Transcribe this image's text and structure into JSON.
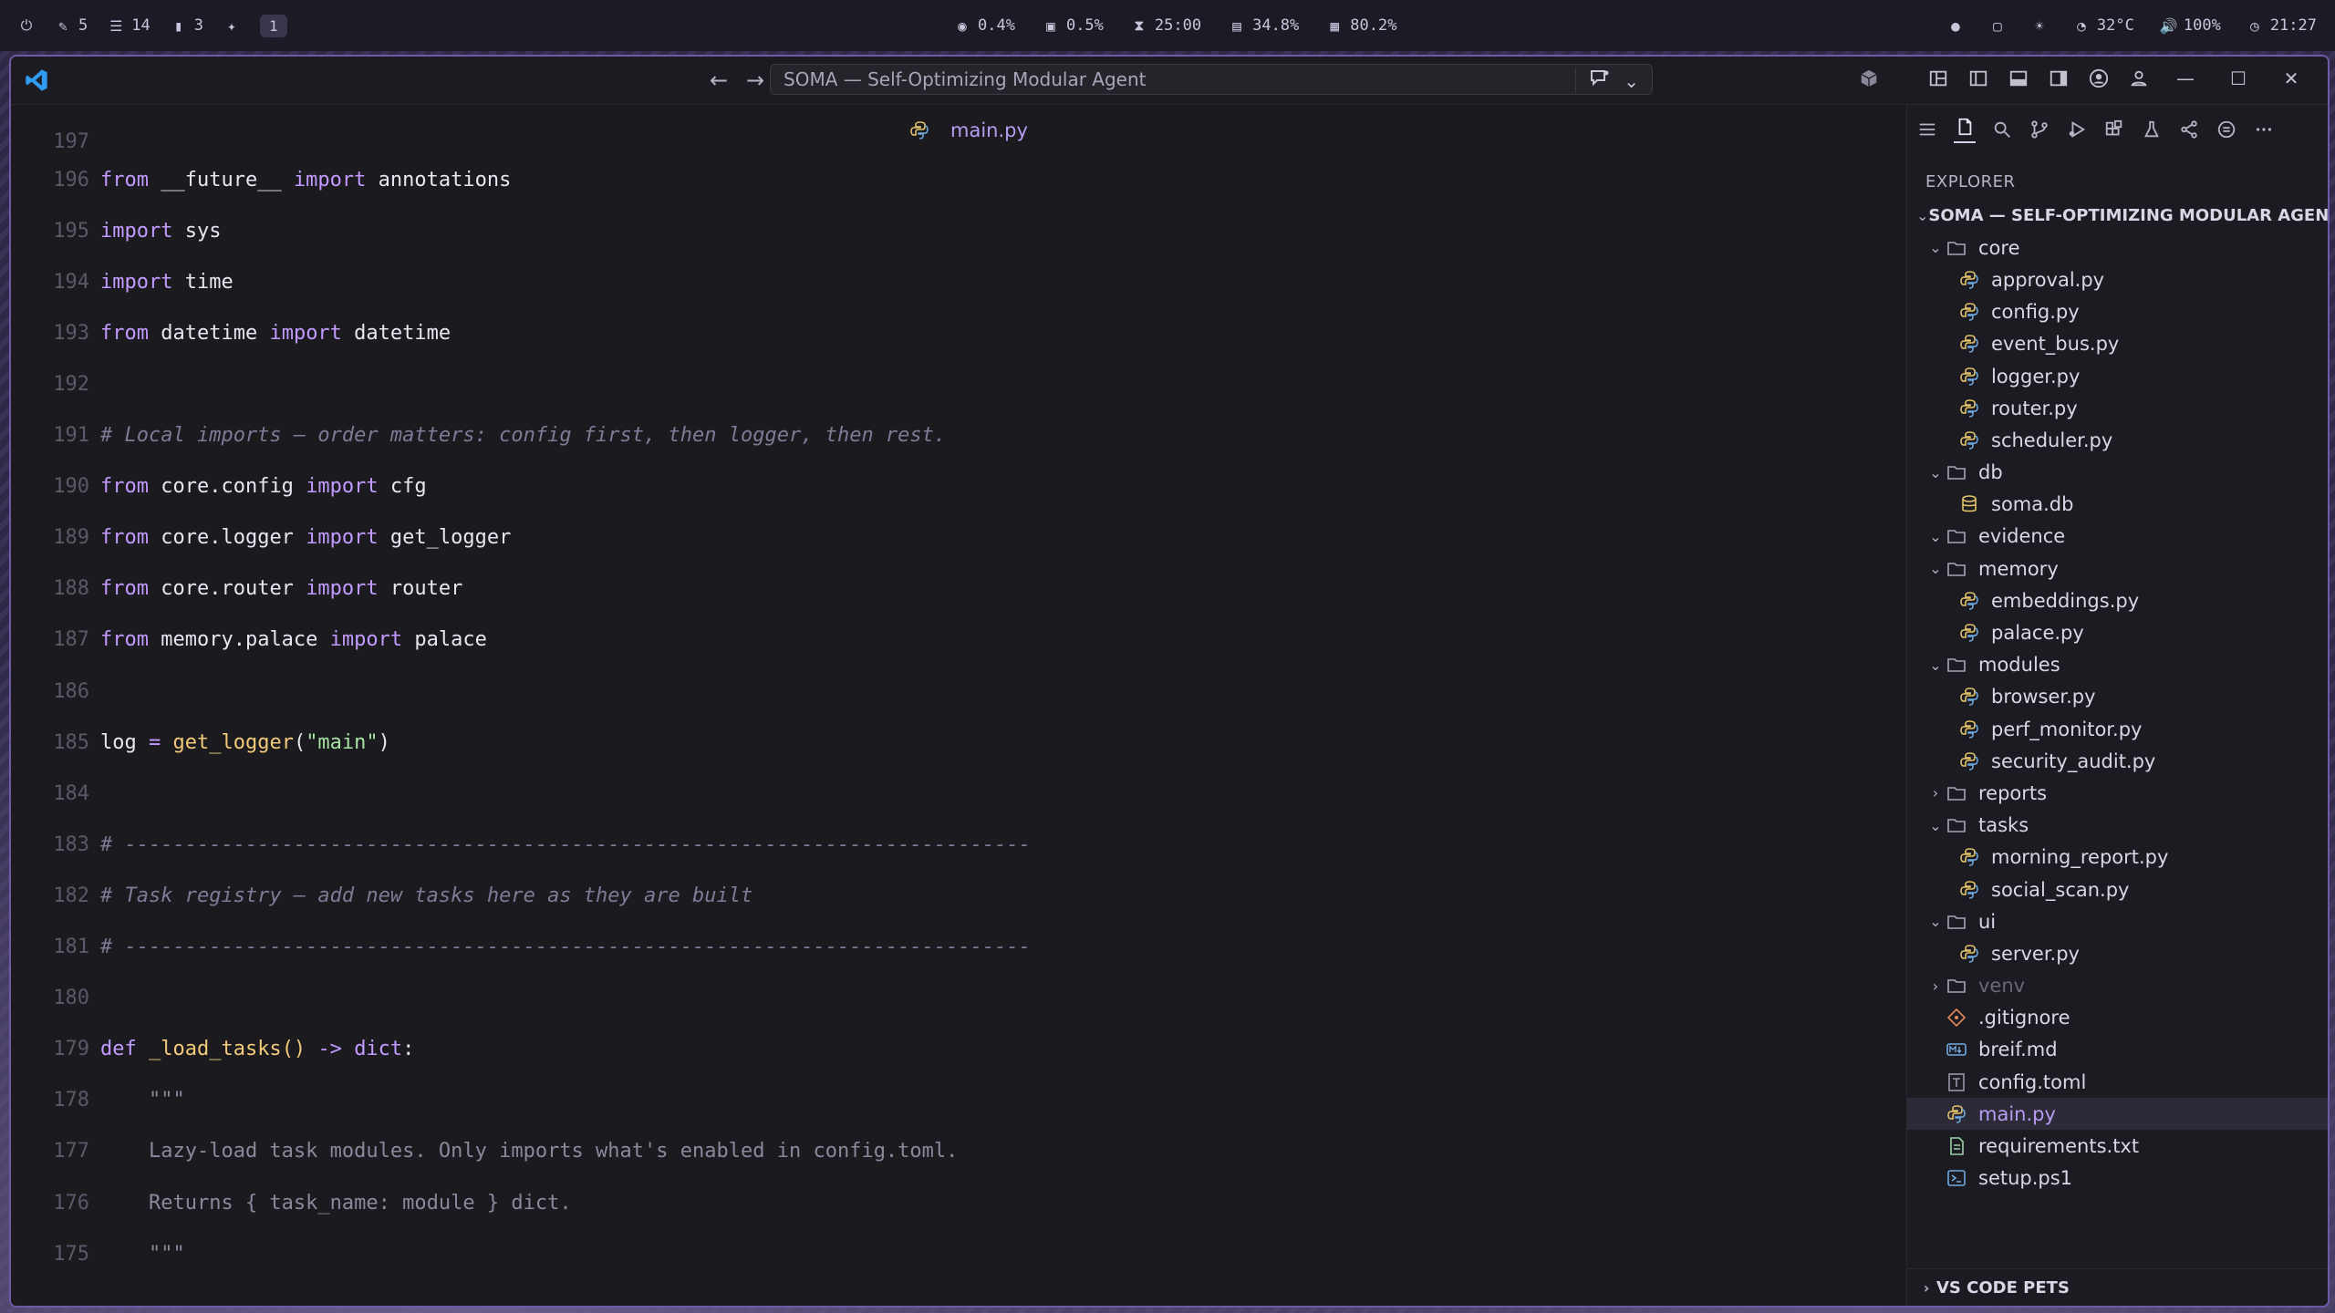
{
  "sysbar": {
    "left": [
      {
        "icon": "power-icon",
        "text": ""
      },
      {
        "icon": "edit-icon",
        "text": "5"
      },
      {
        "icon": "checklist-icon",
        "text": "14"
      },
      {
        "icon": "trash-icon",
        "text": "3"
      },
      {
        "icon": "sparkle-icon",
        "text": ""
      }
    ],
    "workspace": "1",
    "center": [
      {
        "icon": "cpu-icon",
        "text": "0.4%"
      },
      {
        "icon": "gpu-icon",
        "text": "0.5%"
      },
      {
        "icon": "hourglass-icon",
        "text": "25:00"
      },
      {
        "icon": "memory-icon",
        "text": "34.8%"
      },
      {
        "icon": "disk-icon",
        "text": "80.2%"
      }
    ],
    "right": [
      {
        "icon": "circle-icon",
        "text": ""
      },
      {
        "icon": "screenshot-icon",
        "text": ""
      },
      {
        "icon": "brightness-icon",
        "text": ""
      },
      {
        "icon": "temperature-icon",
        "text": "32°C"
      },
      {
        "icon": "volume-icon",
        "text": "100%"
      },
      {
        "icon": "clock-icon",
        "text": "21:27"
      }
    ]
  },
  "titlebar": {
    "command_center": "SOMA — Self-Optimizing Modular Agent"
  },
  "editor": {
    "tab_title": "main.py",
    "top_partial_line_number": "197",
    "lines": [
      {
        "n": "196",
        "tokens": [
          [
            "kw",
            "from "
          ],
          [
            "id",
            "__future__ "
          ],
          [
            "kw",
            "import "
          ],
          [
            "id",
            "annotations"
          ]
        ]
      },
      {
        "n": "195",
        "tokens": [
          [
            "kw",
            "import "
          ],
          [
            "id",
            "sys"
          ]
        ]
      },
      {
        "n": "194",
        "tokens": [
          [
            "kw",
            "import "
          ],
          [
            "id",
            "time"
          ]
        ]
      },
      {
        "n": "193",
        "tokens": [
          [
            "kw",
            "from "
          ],
          [
            "id",
            "datetime "
          ],
          [
            "kw",
            "import "
          ],
          [
            "id",
            "datetime"
          ]
        ]
      },
      {
        "n": "192",
        "tokens": []
      },
      {
        "n": "191",
        "tokens": [
          [
            "cm",
            "# Local imports — order matters: config first, then logger, then rest."
          ]
        ]
      },
      {
        "n": "190",
        "tokens": [
          [
            "kw",
            "from "
          ],
          [
            "id",
            "core.config "
          ],
          [
            "kw",
            "import "
          ],
          [
            "id",
            "cfg"
          ]
        ]
      },
      {
        "n": "189",
        "tokens": [
          [
            "kw",
            "from "
          ],
          [
            "id",
            "core.logger "
          ],
          [
            "kw",
            "import "
          ],
          [
            "id",
            "get_logger"
          ]
        ]
      },
      {
        "n": "188",
        "tokens": [
          [
            "kw",
            "from "
          ],
          [
            "id",
            "core.router "
          ],
          [
            "kw",
            "import "
          ],
          [
            "id",
            "router"
          ]
        ]
      },
      {
        "n": "187",
        "tokens": [
          [
            "kw",
            "from "
          ],
          [
            "id",
            "memory.palace "
          ],
          [
            "kw",
            "import "
          ],
          [
            "id",
            "palace"
          ]
        ]
      },
      {
        "n": "186",
        "tokens": []
      },
      {
        "n": "185",
        "tokens": [
          [
            "id",
            "log "
          ],
          [
            "op",
            "= "
          ],
          [
            "fn",
            "get_logger"
          ],
          [
            "id",
            "("
          ],
          [
            "str",
            "\"main\""
          ],
          [
            "id",
            ")"
          ]
        ]
      },
      {
        "n": "184",
        "tokens": []
      },
      {
        "n": "183",
        "tokens": [
          [
            "cm",
            "# ---------------------------------------------------------------------------"
          ]
        ]
      },
      {
        "n": "182",
        "tokens": [
          [
            "cm",
            "# Task registry — add new tasks here as they are built"
          ]
        ]
      },
      {
        "n": "181",
        "tokens": [
          [
            "cm",
            "# ---------------------------------------------------------------------------"
          ]
        ]
      },
      {
        "n": "180",
        "tokens": []
      },
      {
        "n": "179",
        "tokens": [
          [
            "kw",
            "def "
          ],
          [
            "fn",
            "_load_tasks"
          ],
          [
            "fn",
            "() "
          ],
          [
            "op",
            "-> "
          ],
          [
            "kw",
            "dict"
          ],
          [
            "id",
            ":"
          ]
        ]
      },
      {
        "n": "178",
        "tokens": [
          [
            "doc",
            "    \"\"\""
          ]
        ]
      },
      {
        "n": "177",
        "tokens": [
          [
            "doc",
            "    Lazy-load task modules. Only imports what's enabled in config.toml."
          ]
        ]
      },
      {
        "n": "176",
        "tokens": [
          [
            "doc",
            "    Returns { task_name: module } dict."
          ]
        ]
      },
      {
        "n": "175",
        "tokens": [
          [
            "doc",
            "    \"\"\""
          ]
        ]
      }
    ]
  },
  "sidebar": {
    "explorer_label": "EXPLORER",
    "root": "SOMA — SELF-OPTIMIZING MODULAR AGENT",
    "items": [
      {
        "label": "core",
        "kind": "folder",
        "open": true,
        "depth": 1
      },
      {
        "label": "approval.py",
        "kind": "py",
        "depth": 2
      },
      {
        "label": "config.py",
        "kind": "py",
        "depth": 2
      },
      {
        "label": "event_bus.py",
        "kind": "py",
        "depth": 2
      },
      {
        "label": "logger.py",
        "kind": "py",
        "depth": 2
      },
      {
        "label": "router.py",
        "kind": "py",
        "depth": 2
      },
      {
        "label": "scheduler.py",
        "kind": "py",
        "depth": 2
      },
      {
        "label": "db",
        "kind": "folder",
        "open": true,
        "depth": 1
      },
      {
        "label": "soma.db",
        "kind": "db",
        "depth": 2
      },
      {
        "label": "evidence",
        "kind": "folder",
        "open": true,
        "depth": 1
      },
      {
        "label": "memory",
        "kind": "folder",
        "open": true,
        "depth": 1
      },
      {
        "label": "embeddings.py",
        "kind": "py",
        "depth": 2
      },
      {
        "label": "palace.py",
        "kind": "py",
        "depth": 2
      },
      {
        "label": "modules",
        "kind": "folder",
        "open": true,
        "depth": 1
      },
      {
        "label": "browser.py",
        "kind": "py",
        "depth": 2
      },
      {
        "label": "perf_monitor.py",
        "kind": "py",
        "depth": 2
      },
      {
        "label": "security_audit.py",
        "kind": "py",
        "depth": 2
      },
      {
        "label": "reports",
        "kind": "folder",
        "open": false,
        "depth": 1
      },
      {
        "label": "tasks",
        "kind": "folder",
        "open": true,
        "depth": 1
      },
      {
        "label": "morning_report.py",
        "kind": "py",
        "depth": 2
      },
      {
        "label": "social_scan.py",
        "kind": "py",
        "depth": 2
      },
      {
        "label": "ui",
        "kind": "folder",
        "open": true,
        "depth": 1
      },
      {
        "label": "server.py",
        "kind": "py",
        "depth": 2
      },
      {
        "label": "venv",
        "kind": "folder",
        "open": false,
        "depth": 1,
        "dim": true
      },
      {
        "label": ".gitignore",
        "kind": "git",
        "depth": 1
      },
      {
        "label": "breif.md",
        "kind": "md",
        "depth": 1
      },
      {
        "label": "config.toml",
        "kind": "toml",
        "depth": 1
      },
      {
        "label": "main.py",
        "kind": "py",
        "depth": 1,
        "selected": true
      },
      {
        "label": "requirements.txt",
        "kind": "txt",
        "depth": 1
      },
      {
        "label": "setup.ps1",
        "kind": "ps1",
        "depth": 1
      }
    ],
    "pets_label": "VS CODE PETS"
  },
  "colors": {
    "accent": "#6f5aa8",
    "keyword": "#c29bff",
    "function": "#f3c97a",
    "string": "#a6e3a1",
    "comment": "#7f7a95",
    "tab_title": "#b79cf2"
  }
}
